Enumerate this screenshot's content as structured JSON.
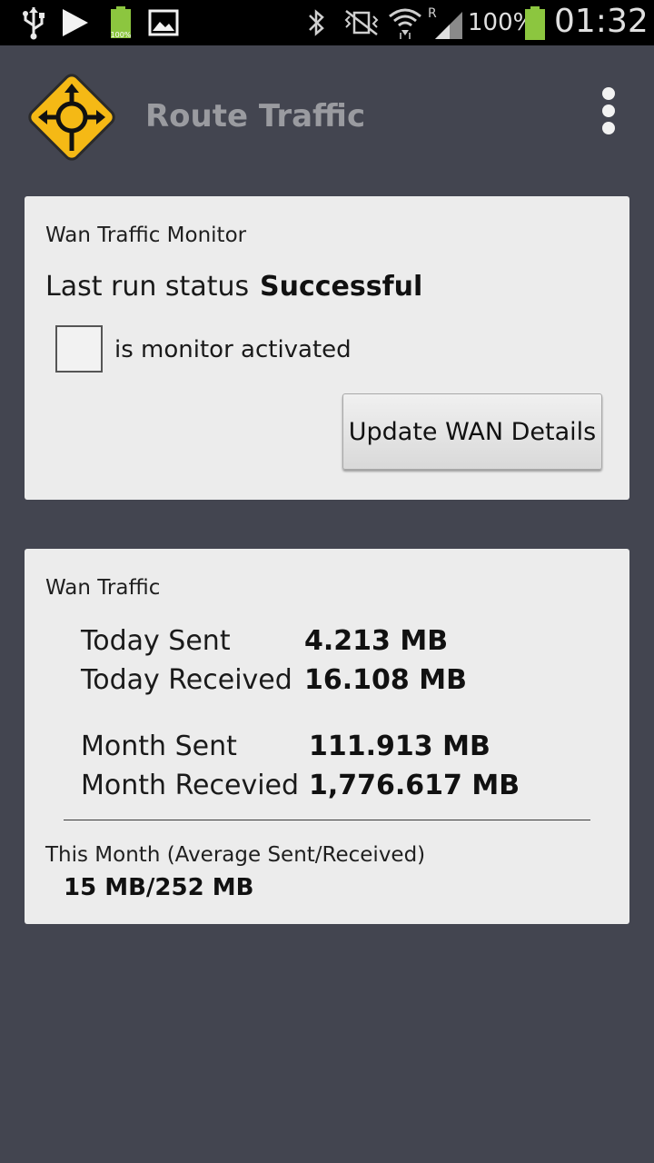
{
  "status_bar": {
    "battery_small_label": "100%",
    "network_roaming": "R",
    "battery_percent": "100%",
    "time": "01:32"
  },
  "app_bar": {
    "title": "Route Traffic",
    "icon": "roundabout-sign-icon",
    "menu_icon": "overflow-menu-icon"
  },
  "monitor_card": {
    "title": "Wan Traffic Monitor",
    "last_run_label": "Last run status",
    "last_run_value": "Successful",
    "checkbox_label": "is monitor activated",
    "checkbox_checked": false,
    "update_button_label": "Update WAN Details"
  },
  "traffic_card": {
    "title": "Wan Traffic",
    "today_sent_label": "Today Sent",
    "today_sent_value": "4.213 MB",
    "today_received_label": "Today Received",
    "today_received_value": "16.108 MB",
    "month_sent_label": "Month Sent",
    "month_sent_value": "111.913 MB",
    "month_received_label": "Month Recevied",
    "month_received_value": "1,776.617 MB",
    "average_label": "This Month (Average Sent/Received)",
    "average_value": "15 MB/252 MB"
  },
  "colors": {
    "background": "#434550",
    "card": "#ececec",
    "icon_yellow": "#f5b915",
    "title_gray": "#9a9ba0"
  }
}
